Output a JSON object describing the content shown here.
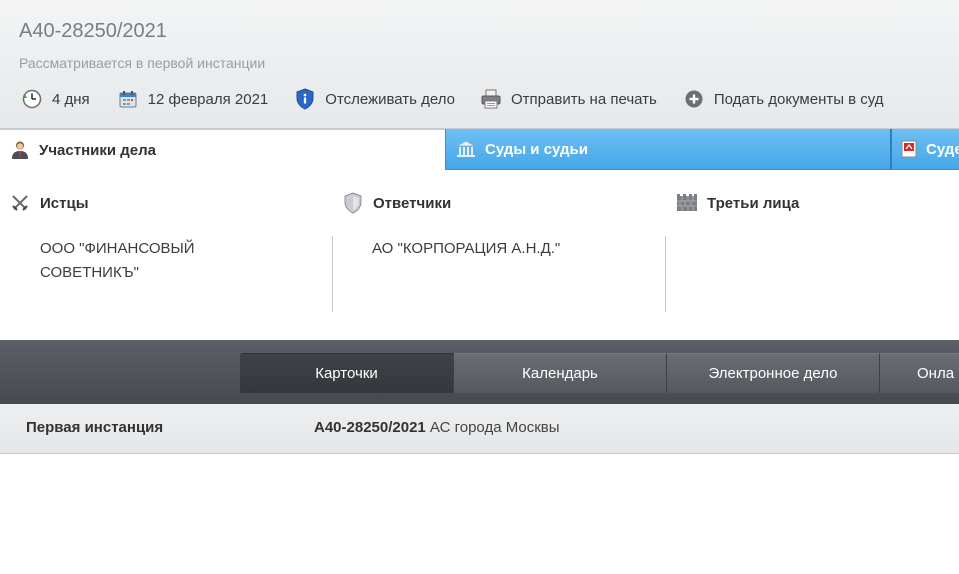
{
  "case": {
    "number": "А40-28250/2021",
    "status": "Рассматривается в первой инстанции"
  },
  "actions": {
    "days": "4 дня",
    "date": "12 февраля 2021",
    "track": "Отслеживать дело",
    "print": "Отправить на печать",
    "submit": "Подать документы в суд"
  },
  "tabs": {
    "participants": "Участники дела",
    "courts": "Суды и судьи",
    "third": "Суде"
  },
  "participants": {
    "plaintiffs": {
      "title": "Истцы",
      "entries": [
        "ООО \"ФИНАНСОВЫЙ",
        "СОВЕТНИКЪ\""
      ]
    },
    "defendants": {
      "title": "Ответчики",
      "entries": [
        "АО \"КОРПОРАЦИЯ А.Н.Д.\""
      ]
    },
    "third_parties": {
      "title": "Третьи лица",
      "entries": []
    }
  },
  "nav": {
    "cards": "Карточки",
    "calendar": "Календарь",
    "electronic": "Электронное дело",
    "online": "Онла"
  },
  "instance": {
    "label": "Первая инстанция",
    "case_number": "А40-28250/2021",
    "court": " АС города Москвы"
  },
  "colors": {
    "tab_active_blue": "#46a6e8",
    "navbar_dark": "#464a4f",
    "header_bg": "#e6e8ea"
  }
}
